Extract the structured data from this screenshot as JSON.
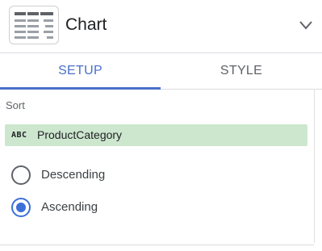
{
  "header": {
    "title": "Chart",
    "icon": "table-chart-icon",
    "collapse_icon": "chevron-down-icon"
  },
  "tabs": [
    {
      "label": "SETUP",
      "active": true
    },
    {
      "label": "STYLE",
      "active": false
    }
  ],
  "sort": {
    "section_label": "Sort",
    "field": {
      "type_badge": "ABC",
      "name": "ProductCategory",
      "chip_color": "#cde7cf"
    },
    "options": [
      {
        "label": "Descending",
        "selected": false
      },
      {
        "label": "Ascending",
        "selected": true
      }
    ]
  },
  "colors": {
    "accent": "#4a6fc9",
    "radio_selected": "#3c6fd8",
    "text_primary": "#202124",
    "text_secondary": "#5f6368"
  }
}
